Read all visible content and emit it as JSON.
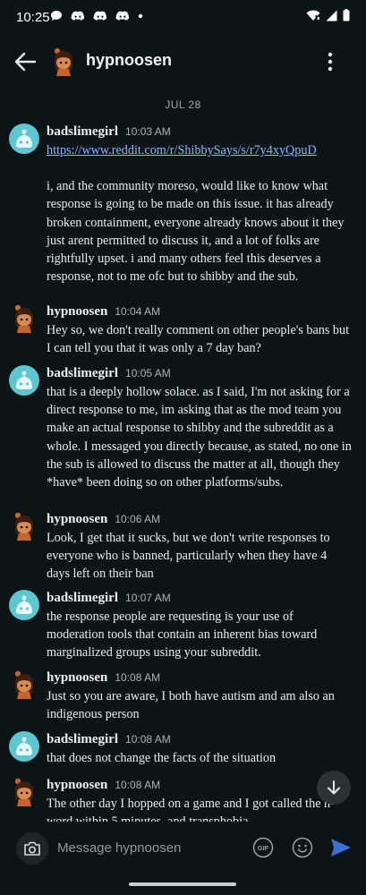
{
  "status_bar": {
    "time": "10:25"
  },
  "header": {
    "title": "hypnoosen"
  },
  "date_separator": "JUL 28",
  "messages": [
    {
      "author": "badslimegirl",
      "time": "10:03 AM",
      "link": "https://www.reddit.com/r/ShibbySays/s/r7y4xyQpuD",
      "text": "i, and the community moreso, would like to know what response is going to be made on this issue. it has already broken containment, everyone already knows about it they just arent permitted to discuss it, and a lot of folks are rightfully upset. i and many others feel this deserves a response, not to me ofc but to shibby and the sub."
    },
    {
      "author": "hypnoosen",
      "time": "10:04 AM",
      "text": "Hey so, we don't really comment on other people's bans but I can tell you that it was only a 7 day ban?"
    },
    {
      "author": "badslimegirl",
      "time": "10:05 AM",
      "text": "that is a deeply hollow solace. as I said, I'm not asking for a direct response to me, im asking that as the mod team you make an actual response to shibby and the subreddit as a whole. I messaged you directly because, as stated, no one in the sub is allowed to discuss the matter at all, though they *have* been doing so on other platforms/subs."
    },
    {
      "author": "hypnoosen",
      "time": "10:06 AM",
      "text": "Look, I get that it sucks, but we don't write responses to everyone who is banned, particularly when they have 4 days left on their ban"
    },
    {
      "author": "badslimegirl",
      "time": "10:07 AM",
      "text": "the response people are requesting is your use of moderation tools that contain an inherent bias toward marginalized groups using your subreddit."
    },
    {
      "author": "hypnoosen",
      "time": "10:08 AM",
      "text": "Just so you are aware, I both have autism and am also an indigenous person"
    },
    {
      "author": "badslimegirl",
      "time": "10:08 AM",
      "text": "that does not change the facts of the situation"
    },
    {
      "author": "hypnoosen",
      "time": "10:08 AM",
      "text": "The other day I hopped on a game and I got called the n-word within 5 minutes, and transphobia"
    }
  ],
  "composer": {
    "placeholder": "Message hypnoosen",
    "gif_label": "GIF"
  },
  "icons": {
    "back": "arrow-left-icon",
    "more": "more-vertical-icon",
    "camera": "camera-icon",
    "gif": "gif-icon",
    "emoji": "emoji-icon",
    "send": "send-icon",
    "scroll": "arrow-down-icon"
  },
  "colors": {
    "background": "#0b1416",
    "link": "#8cb3ff",
    "send": "#3b6fd6",
    "badslimegirl_avatar": "#5bc7d0",
    "hypnoosen_avatar": "#c8642a"
  }
}
